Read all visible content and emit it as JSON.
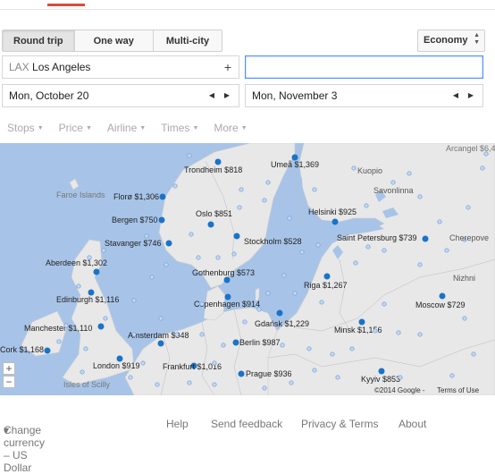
{
  "colors": {
    "accent": "#dd4b39",
    "water": "#a7c4e8",
    "land": "#e8e8e8",
    "dot": "#1a73c8"
  },
  "trip": {
    "round_trip": "Round trip",
    "one_way": "One way",
    "multi_city": "Multi-city"
  },
  "cabin_class": "Economy",
  "origin": {
    "code": "LAX",
    "city": "Los Angeles",
    "add_icon": "plus-icon"
  },
  "destination": {
    "value": ""
  },
  "dates": {
    "depart": "Mon, October 20",
    "return": "Mon, November 3"
  },
  "filters": [
    "Stops",
    "Price",
    "Airline",
    "Times",
    "More"
  ],
  "map": {
    "destinations": [
      {
        "name": "Trondheim",
        "price": "$818"
      },
      {
        "name": "Umeå",
        "price": "$1,369"
      },
      {
        "name": "Florø",
        "price": "$1,306"
      },
      {
        "name": "Bergen",
        "price": "$750"
      },
      {
        "name": "Oslo",
        "price": "$851"
      },
      {
        "name": "Helsinki",
        "price": "$925"
      },
      {
        "name": "Stavanger",
        "price": "$746"
      },
      {
        "name": "Stockholm",
        "price": "$528"
      },
      {
        "name": "Saint Petersburg",
        "price": "$739"
      },
      {
        "name": "Aberdeen",
        "price": "$1,302"
      },
      {
        "name": "Gothenburg",
        "price": "$573"
      },
      {
        "name": "Riga",
        "price": "$1,267"
      },
      {
        "name": "Edinburgh",
        "price": "$1,116"
      },
      {
        "name": "Copenhagen",
        "price": "$914"
      },
      {
        "name": "Moscow",
        "price": "$729"
      },
      {
        "name": "Gdańsk",
        "price": "$1,229"
      },
      {
        "name": "Manchester",
        "price": "$1,110"
      },
      {
        "name": "Amsterdam",
        "price": "$948"
      },
      {
        "name": "Minsk",
        "price": "$1,156"
      },
      {
        "name": "Berlin",
        "price": "$987"
      },
      {
        "name": "Cork",
        "price": "$1,168"
      },
      {
        "name": "London",
        "price": "$919"
      },
      {
        "name": "Frankfurt",
        "price": "$1,016"
      },
      {
        "name": "Kyyiv",
        "price": "$853"
      },
      {
        "name": "Prague",
        "price": "$936"
      }
    ],
    "place_labels": [
      "Arcangel $6,4",
      "Kuopio",
      "Savonlinna",
      "Faroe Islands",
      "Cherepove",
      "Nizhni",
      "Isles of Scilly"
    ],
    "zoom_in": "+",
    "zoom_out": "−",
    "copyright": "©2014 Google -",
    "terms": "Terms of Use"
  },
  "footer": {
    "currency": "Change currency – US Dollar",
    "currency_caret": "▾",
    "help": "Help",
    "feedback": "Send feedback",
    "privacy": "Privacy & Terms",
    "about": "About"
  }
}
